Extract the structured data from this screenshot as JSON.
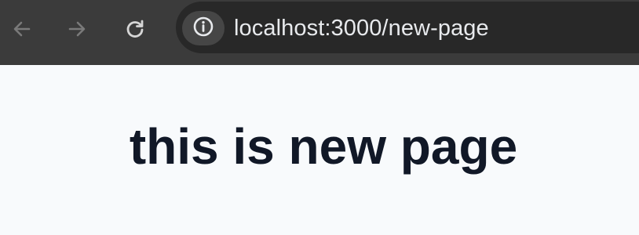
{
  "browser": {
    "nav": {
      "back_icon": "arrow-left-icon",
      "forward_icon": "arrow-right-icon",
      "reload_icon": "reload-icon"
    },
    "address_bar": {
      "info_icon": "info-icon",
      "url": "localhost:3000/new-page"
    }
  },
  "page": {
    "heading": "this is new page"
  },
  "colors": {
    "toolbar_bg": "#3b3b3b",
    "omnibox_bg": "#282828",
    "page_bg": "#f8fafc",
    "heading_text": "#111827"
  }
}
